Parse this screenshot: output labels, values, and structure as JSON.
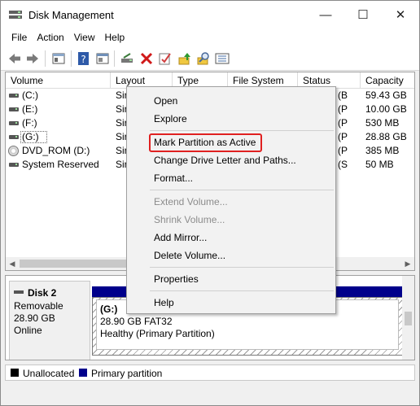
{
  "window": {
    "title": "Disk Management",
    "minimize": "—",
    "maximize": "☐",
    "close": "✕"
  },
  "menu": [
    "File",
    "Action",
    "View",
    "Help"
  ],
  "toolbar_icons": [
    "back-icon",
    "forward-icon",
    "show-hide-console-tree-icon",
    "help-icon",
    "properties-icon",
    "connect-drive-icon",
    "delete-icon",
    "check-icon",
    "export-icon",
    "search-icon",
    "list-view-icon"
  ],
  "columns": [
    "Volume",
    "Layout",
    "Type",
    "File System",
    "Status",
    "Capacity"
  ],
  "volumes": [
    {
      "name": "(C:)",
      "layout": "Sir",
      "status": "(B",
      "capacity": "59.43 GB",
      "icon": "disk-icon"
    },
    {
      "name": "(E:)",
      "layout": "Sir",
      "status": "(P",
      "capacity": "10.00 GB",
      "icon": "disk-icon"
    },
    {
      "name": "(F:)",
      "layout": "Sir",
      "status": "(P",
      "capacity": "530 MB",
      "icon": "disk-icon"
    },
    {
      "name": "(G:)",
      "layout": "Sir",
      "status": "(P",
      "capacity": "28.88 GB",
      "icon": "disk-icon"
    },
    {
      "name": "DVD_ROM (D:)",
      "layout": "Sir",
      "status": "(P",
      "capacity": "385 MB",
      "icon": "cd-icon"
    },
    {
      "name": "System Reserved",
      "layout": "Sir",
      "status": "(S",
      "capacity": "50 MB",
      "icon": "disk-icon"
    }
  ],
  "disk": {
    "name": "Disk 2",
    "kind": "Removable",
    "size": "28.90 GB",
    "state": "Online",
    "partition": {
      "label": "(G:)",
      "detail": "28.90 GB FAT32",
      "health": "Healthy (Primary Partition)"
    }
  },
  "legend": [
    {
      "label": "Unallocated",
      "color": "#000000"
    },
    {
      "label": "Primary partition",
      "color": "#00008b"
    }
  ],
  "context_menu": [
    {
      "label": "Open",
      "enabled": true
    },
    {
      "label": "Explore",
      "enabled": true
    },
    {
      "label": "Mark Partition as Active",
      "enabled": true,
      "highlighted": true
    },
    {
      "label": "Change Drive Letter and Paths...",
      "enabled": true
    },
    {
      "label": "Format...",
      "enabled": true
    },
    {
      "label": "Extend Volume...",
      "enabled": false
    },
    {
      "label": "Shrink Volume...",
      "enabled": false
    },
    {
      "label": "Add Mirror...",
      "enabled": true
    },
    {
      "label": "Delete Volume...",
      "enabled": true
    },
    {
      "label": "Properties",
      "enabled": true
    },
    {
      "label": "Help",
      "enabled": true
    }
  ],
  "colors": {
    "primary_partition": "#00008b",
    "highlight_border": "#e02020"
  }
}
